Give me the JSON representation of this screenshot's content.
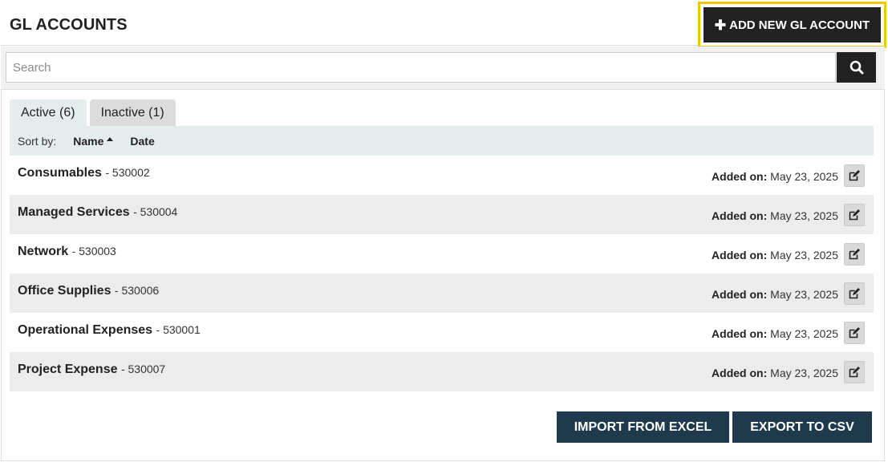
{
  "header": {
    "title": "GL ACCOUNTS",
    "add_button_label": "ADD NEW GL ACCOUNT",
    "add_button_icon": "plus-icon",
    "highlight_color": "#f5c400"
  },
  "search": {
    "placeholder": "Search",
    "value": "",
    "button_icon": "search-icon"
  },
  "tabs": [
    {
      "label": "Active (6)",
      "selected": true
    },
    {
      "label": "Inactive (1)",
      "selected": false
    }
  ],
  "sort": {
    "label": "Sort by:",
    "options": [
      "Name",
      "Date"
    ],
    "active": "Name",
    "direction_icon": "caret-up-icon"
  },
  "accounts": [
    {
      "name": "Consumables",
      "code": "- 530002",
      "added_label": "Added on:",
      "added_date": "May 23, 2025"
    },
    {
      "name": "Managed Services",
      "code": "- 530004",
      "added_label": "Added on:",
      "added_date": "May 23, 2025"
    },
    {
      "name": "Network",
      "code": "- 530003",
      "added_label": "Added on:",
      "added_date": "May 23, 2025"
    },
    {
      "name": "Office Supplies",
      "code": "- 530006",
      "added_label": "Added on:",
      "added_date": "May 23, 2025"
    },
    {
      "name": "Operational Expenses",
      "code": "- 530001",
      "added_label": "Added on:",
      "added_date": "May 23, 2025"
    },
    {
      "name": "Project Expense",
      "code": "- 530007",
      "added_label": "Added on:",
      "added_date": "May 23, 2025"
    }
  ],
  "footer": {
    "import_label": "IMPORT FROM EXCEL",
    "export_label": "EXPORT TO CSV"
  },
  "colors": {
    "primary_dark": "#222222",
    "action_navy": "#1e3a4c",
    "tab_active": "#e5ecee",
    "row_alt": "#ececec"
  }
}
